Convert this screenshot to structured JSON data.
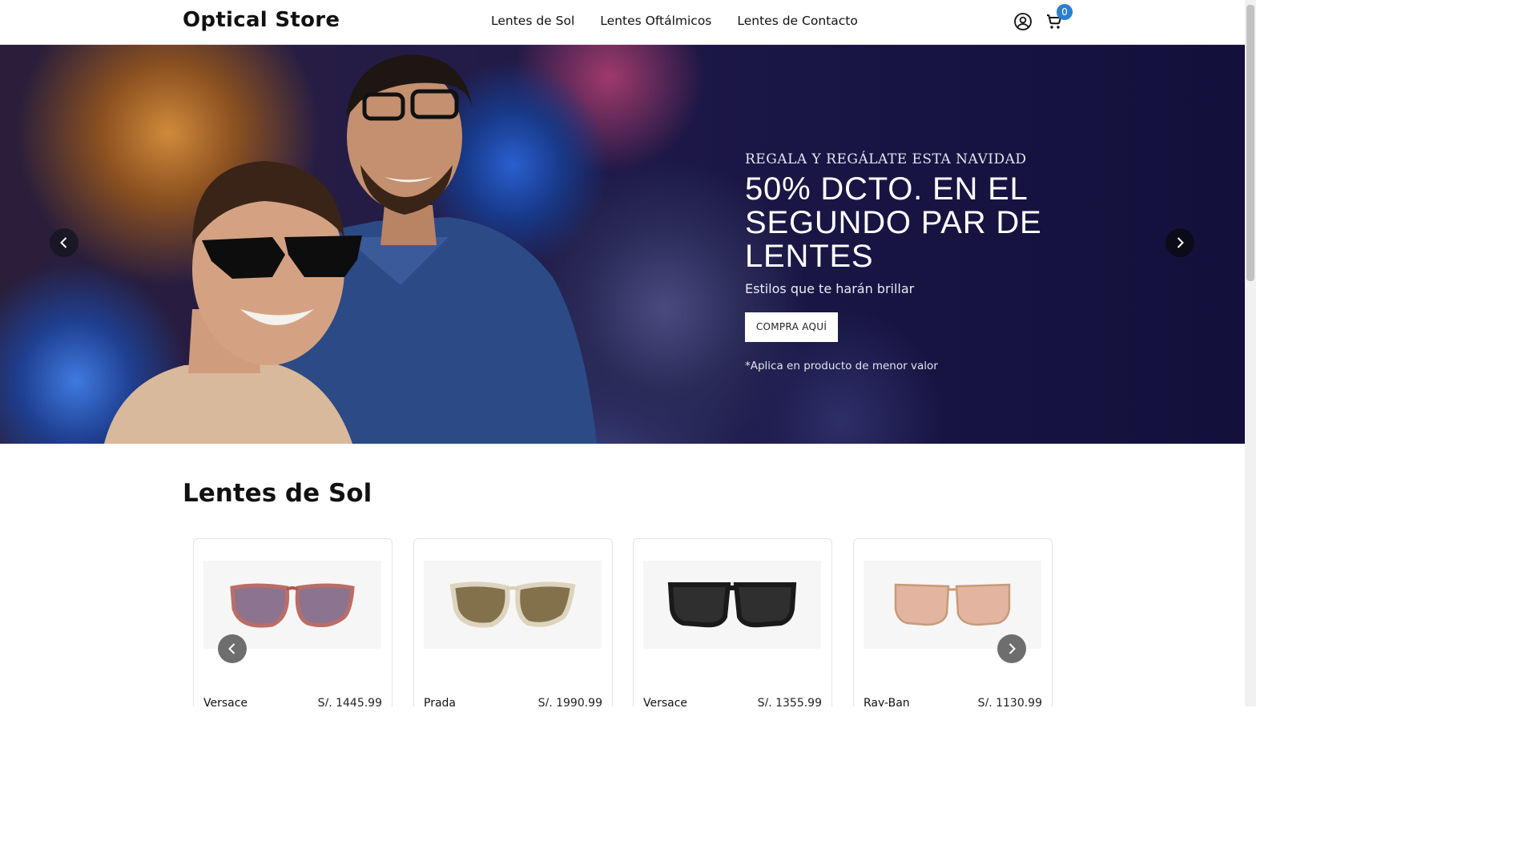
{
  "brand": "Optical Store",
  "nav": [
    "Lentes de Sol",
    "Lentes Oftálmicos",
    "Lentes de Contacto"
  ],
  "header_icons": {
    "account": "user-circle-icon",
    "cart": "cart-icon"
  },
  "cart_count": "0",
  "hero": {
    "eyebrow": "REGALA Y REGÁLATE ESTA NAVIDAD",
    "headline": "50% DCTO. EN EL SEGUNDO PAR DE LENTES",
    "subtitle": "Estilos que te harán brillar",
    "cta": "COMPRA AQUÍ",
    "note": "*Aplica en producto de menor valor"
  },
  "section": {
    "title": "Lentes de Sol",
    "products": [
      {
        "brand": "Versace",
        "price": "S/. 1445.99",
        "frame_color": "#b0564f",
        "lens_color": "#7a5d7e"
      },
      {
        "brand": "Prada",
        "price": "S/. 1990.99",
        "frame_color": "#d9cfb6",
        "lens_color": "#6e5a2e"
      },
      {
        "brand": "Versace",
        "price": "S/. 1355.99",
        "frame_color": "#1a1a1a",
        "lens_color": "#2f2f2f"
      },
      {
        "brand": "Ray-Ban",
        "price": "S/. 1130.99",
        "frame_color": "#c89a78",
        "lens_color": "#e3b5a0"
      }
    ]
  },
  "accent_color": "#2b7fcf"
}
